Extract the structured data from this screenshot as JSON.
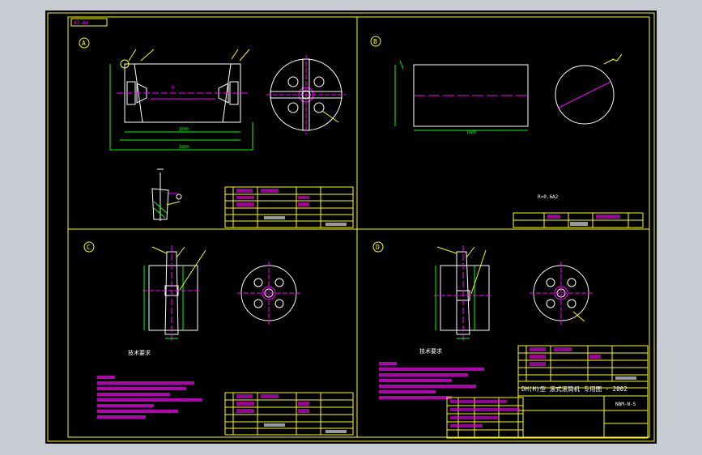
{
  "drawing": {
    "sheet_tag": "A3-A4",
    "panels": [
      {
        "id": "A"
      },
      {
        "id": "B"
      },
      {
        "id": "C"
      },
      {
        "id": "D"
      }
    ],
    "panel_b_note": "R=0.6A2",
    "panel_c_heading": "技术要求",
    "panel_d_heading": "技术要求",
    "title_block": {
      "title": "DH(H)型 滚式滚筒机 专用图 - 2002",
      "code": "NBM-N-S"
    },
    "colors": {
      "background": "#000000",
      "frame": "#ffff00",
      "geometry": "#ffffff",
      "dimension": "#00ff00",
      "center_line": "#ff00ff",
      "hidden_text": "#ff00ff",
      "leader": "#ffff00"
    }
  }
}
